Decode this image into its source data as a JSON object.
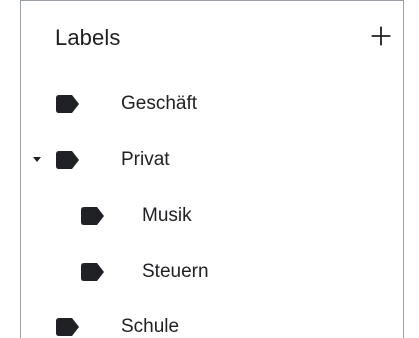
{
  "panel": {
    "title": "Labels",
    "add_icon": "plus-icon",
    "label_icon": "label-tag-icon",
    "expand_icon": "caret-down-icon",
    "colors": {
      "icon": "#202124",
      "text": "#202124",
      "border": "#9aa0a6",
      "background": "#ffffff"
    }
  },
  "labels": [
    {
      "name": "Geschäft",
      "level": 0,
      "expanded": null
    },
    {
      "name": "Privat",
      "level": 0,
      "expanded": true
    },
    {
      "name": "Musik",
      "level": 1,
      "expanded": null
    },
    {
      "name": "Steuern",
      "level": 1,
      "expanded": null
    },
    {
      "name": "Schule",
      "level": 0,
      "expanded": null
    }
  ]
}
